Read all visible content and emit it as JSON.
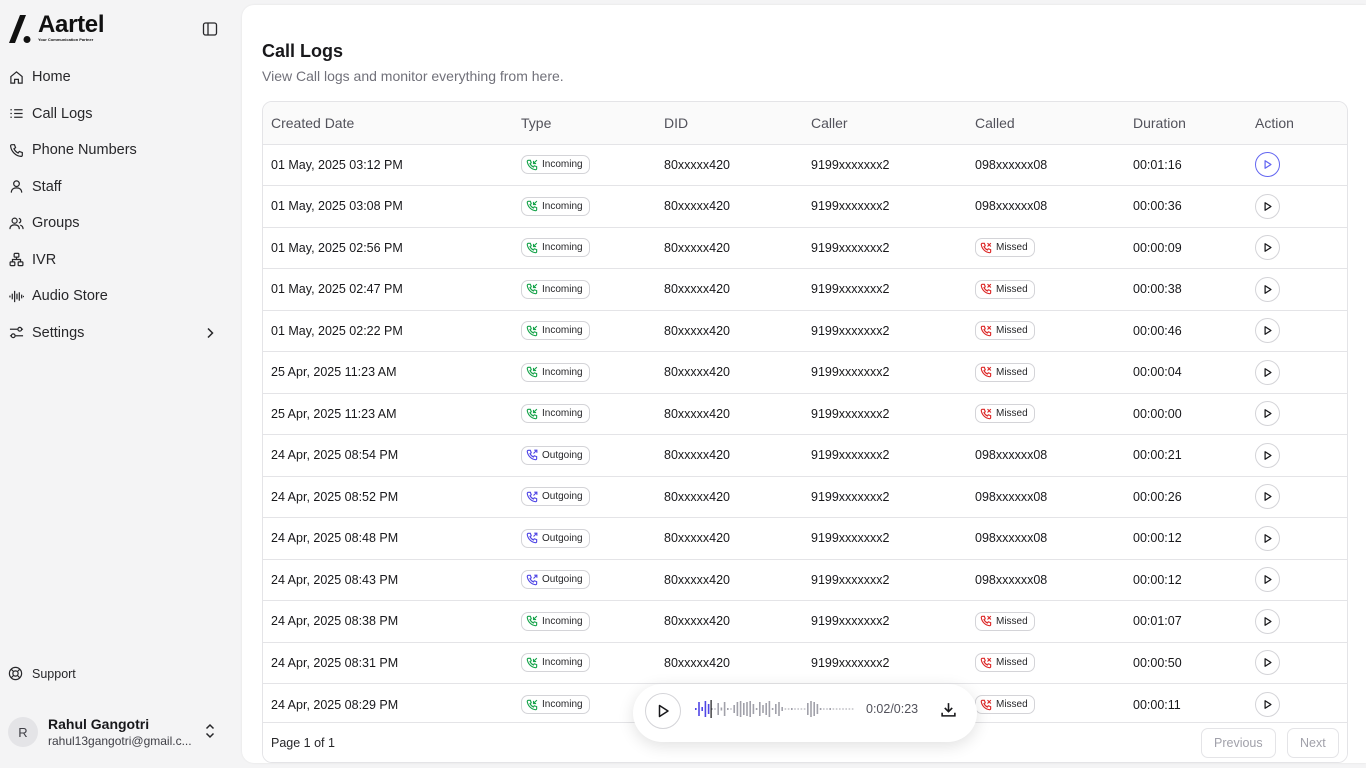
{
  "brand": {
    "name": "Aartel",
    "tagline": "Your Communication Partner"
  },
  "nav": [
    {
      "label": "Home",
      "icon": "home-icon"
    },
    {
      "label": "Call Logs",
      "icon": "list-icon"
    },
    {
      "label": "Phone Numbers",
      "icon": "phone-icon"
    },
    {
      "label": "Staff",
      "icon": "user-icon"
    },
    {
      "label": "Groups",
      "icon": "users-icon"
    },
    {
      "label": "IVR",
      "icon": "network-icon"
    },
    {
      "label": "Audio Store",
      "icon": "audio-waveform-icon"
    },
    {
      "label": "Settings",
      "icon": "settings-sliders-icon"
    }
  ],
  "support": {
    "label": "Support",
    "icon": "life-buoy-icon"
  },
  "user": {
    "initial": "R",
    "name": "Rahul Gangotri",
    "email": "rahul13gangotri@gmail.c..."
  },
  "page": {
    "title": "Call Logs",
    "subtitle": "View Call logs and monitor everything from here."
  },
  "table": {
    "headers": [
      "Created Date",
      "Type",
      "DID",
      "Caller",
      "Called",
      "Duration",
      "Action"
    ],
    "rows": [
      {
        "date": "01 May, 2025 03:12 PM",
        "type": "Incoming",
        "did": "80xxxxx420",
        "caller": "9199xxxxxxx2",
        "called": "098xxxxxx08",
        "called_missed": false,
        "duration": "00:01:16",
        "active": true
      },
      {
        "date": "01 May, 2025 03:08 PM",
        "type": "Incoming",
        "did": "80xxxxx420",
        "caller": "9199xxxxxxx2",
        "called": "098xxxxxx08",
        "called_missed": false,
        "duration": "00:00:36",
        "active": false
      },
      {
        "date": "01 May, 2025 02:56 PM",
        "type": "Incoming",
        "did": "80xxxxx420",
        "caller": "9199xxxxxxx2",
        "called": "Missed",
        "called_missed": true,
        "duration": "00:00:09",
        "active": false
      },
      {
        "date": "01 May, 2025 02:47 PM",
        "type": "Incoming",
        "did": "80xxxxx420",
        "caller": "9199xxxxxxx2",
        "called": "Missed",
        "called_missed": true,
        "duration": "00:00:38",
        "active": false
      },
      {
        "date": "01 May, 2025 02:22 PM",
        "type": "Incoming",
        "did": "80xxxxx420",
        "caller": "9199xxxxxxx2",
        "called": "Missed",
        "called_missed": true,
        "duration": "00:00:46",
        "active": false
      },
      {
        "date": "25 Apr, 2025 11:23 AM",
        "type": "Incoming",
        "did": "80xxxxx420",
        "caller": "9199xxxxxxx2",
        "called": "Missed",
        "called_missed": true,
        "duration": "00:00:04",
        "active": false
      },
      {
        "date": "25 Apr, 2025 11:23 AM",
        "type": "Incoming",
        "did": "80xxxxx420",
        "caller": "9199xxxxxxx2",
        "called": "Missed",
        "called_missed": true,
        "duration": "00:00:00",
        "active": false
      },
      {
        "date": "24 Apr, 2025 08:54 PM",
        "type": "Outgoing",
        "did": "80xxxxx420",
        "caller": "9199xxxxxxx2",
        "called": "098xxxxxx08",
        "called_missed": false,
        "duration": "00:00:21",
        "active": false
      },
      {
        "date": "24 Apr, 2025 08:52 PM",
        "type": "Outgoing",
        "did": "80xxxxx420",
        "caller": "9199xxxxxxx2",
        "called": "098xxxxxx08",
        "called_missed": false,
        "duration": "00:00:26",
        "active": false
      },
      {
        "date": "24 Apr, 2025 08:48 PM",
        "type": "Outgoing",
        "did": "80xxxxx420",
        "caller": "9199xxxxxxx2",
        "called": "098xxxxxx08",
        "called_missed": false,
        "duration": "00:00:12",
        "active": false
      },
      {
        "date": "24 Apr, 2025 08:43 PM",
        "type": "Outgoing",
        "did": "80xxxxx420",
        "caller": "9199xxxxxxx2",
        "called": "098xxxxxx08",
        "called_missed": false,
        "duration": "00:00:12",
        "active": false
      },
      {
        "date": "24 Apr, 2025 08:38 PM",
        "type": "Incoming",
        "did": "80xxxxx420",
        "caller": "9199xxxxxxx2",
        "called": "Missed",
        "called_missed": true,
        "duration": "00:01:07",
        "active": false
      },
      {
        "date": "24 Apr, 2025 08:31 PM",
        "type": "Incoming",
        "did": "80xxxxx420",
        "caller": "9199xxxxxxx2",
        "called": "Missed",
        "called_missed": true,
        "duration": "00:00:50",
        "active": false
      },
      {
        "date": "24 Apr, 2025 08:29 PM",
        "type": "Incoming",
        "did": "",
        "caller": "",
        "called": "Missed",
        "called_missed": true,
        "duration": "00:00:11",
        "active": false
      }
    ]
  },
  "pagination": {
    "info": "Page 1 of 1",
    "previous": "Previous",
    "next": "Next"
  },
  "player": {
    "time": "0:02/0:23",
    "progress": 0.09
  },
  "colors": {
    "accent": "#6366f1",
    "incoming": "#16a34a",
    "outgoing": "#4f46e5",
    "missed": "#dc2626",
    "waveform": "#a1a1aa"
  }
}
